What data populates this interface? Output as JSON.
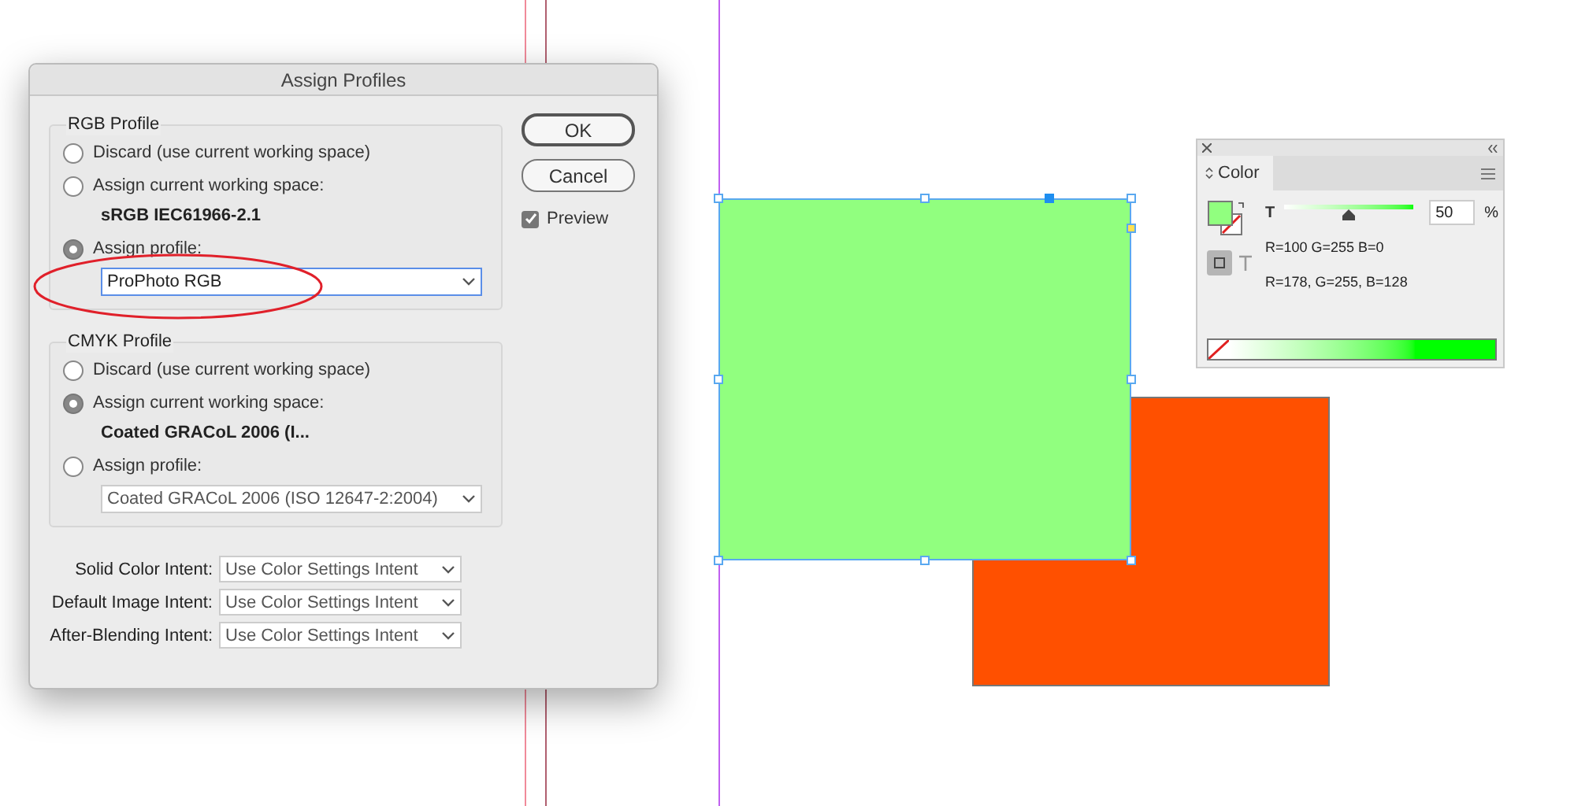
{
  "dialog": {
    "title": "Assign Profiles",
    "groups": [
      {
        "title": "RGB Profile",
        "options": [
          {
            "label": "Discard (use current working space)",
            "selected": false
          },
          {
            "label": "Assign current working space:",
            "selected": false,
            "detail": "sRGB IEC61966-2.1"
          },
          {
            "label": "Assign profile:",
            "selected": true,
            "select": {
              "value": "ProPhoto RGB",
              "focused": true
            }
          }
        ]
      },
      {
        "title": "CMYK Profile",
        "options": [
          {
            "label": "Discard (use current working space)",
            "selected": false
          },
          {
            "label": "Assign current working space:",
            "selected": true,
            "detail": "Coated GRACoL 2006 (I..."
          },
          {
            "label": "Assign profile:",
            "selected": false,
            "select": {
              "value": "Coated GRACoL 2006 (ISO 12647-2:2004)",
              "focused": false
            }
          }
        ]
      }
    ],
    "intents": [
      {
        "label": "Solid Color Intent:",
        "value": "Use Color Settings Intent"
      },
      {
        "label": "Default Image Intent:",
        "value": "Use Color Settings Intent"
      },
      {
        "label": "After-Blending Intent:",
        "value": "Use Color Settings Intent"
      }
    ],
    "buttons": [
      {
        "label": "OK",
        "default": true
      },
      {
        "label": "Cancel",
        "default": false
      }
    ],
    "preview": {
      "label": "Preview",
      "checked": true
    }
  },
  "color_panel": {
    "tab": "Color",
    "tint_label": "T",
    "level": 0.5,
    "value": "50",
    "unit": "%",
    "readouts": [
      "R=100 G=255 B=0",
      "R=178, G=255, B=128"
    ]
  }
}
